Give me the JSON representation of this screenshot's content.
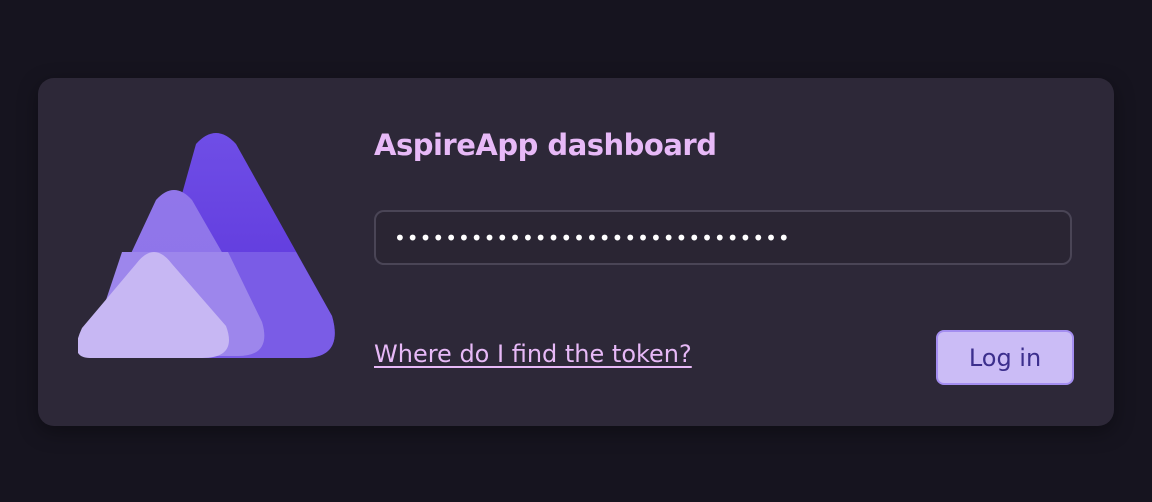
{
  "app": {
    "title": "AspireApp dashboard",
    "logo_icon": "aspire-triangle-logo-icon"
  },
  "token_field": {
    "value": "•••••••••••••••••••••••••••••••"
  },
  "help_link": {
    "label": "Where do I find the token?"
  },
  "login_button": {
    "label": "Log in"
  },
  "colors": {
    "page_background": "#16141f",
    "card_background": "#2d2838",
    "accent_text": "#e7b9f7",
    "button_background": "#cbbcf6",
    "button_text": "#3c2f8d",
    "logo_dark": "#5a32da",
    "logo_mid": "#8f75ea",
    "logo_light": "#c7b7f3"
  }
}
